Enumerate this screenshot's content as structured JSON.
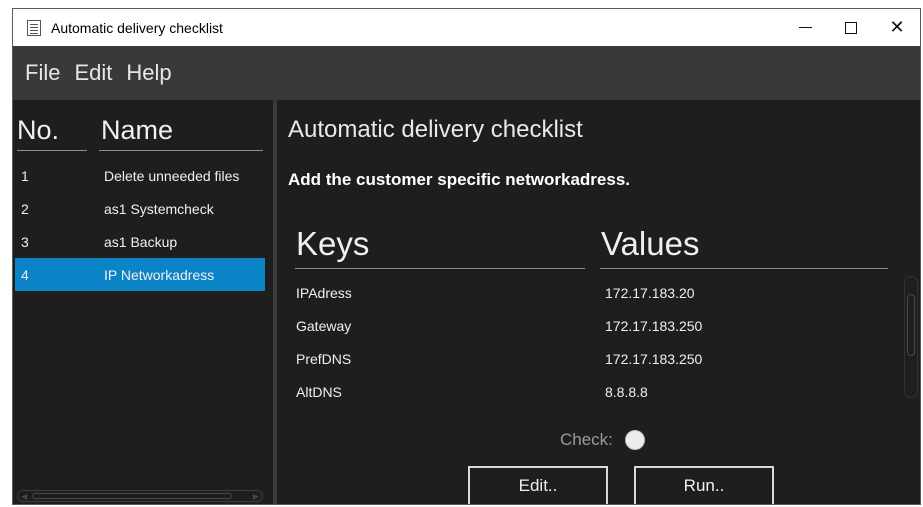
{
  "window": {
    "title": "Automatic delivery checklist",
    "controls": {
      "minimize": "–",
      "maximize": "☐",
      "close": "✕"
    }
  },
  "menu": [
    "File",
    "Edit",
    "Help"
  ],
  "sidebar": {
    "col_no": "No.",
    "col_name": "Name",
    "items": [
      {
        "no": "1",
        "name": "Delete unneeded files"
      },
      {
        "no": "2",
        "name": "as1 Systemcheck"
      },
      {
        "no": "3",
        "name": "as1 Backup"
      },
      {
        "no": "4",
        "name": "IP Networkadress"
      }
    ],
    "selected_index": 3
  },
  "main": {
    "title": "Automatic delivery checklist",
    "subtitle": "Add the customer specific networkadress.",
    "keys_header": "Keys",
    "values_header": "Values",
    "rows": [
      {
        "key": "IPAdress",
        "value": "172.17.183.20"
      },
      {
        "key": "Gateway",
        "value": "172.17.183.250"
      },
      {
        "key": "PrefDNS",
        "value": "172.17.183.250"
      },
      {
        "key": "AltDNS",
        "value": "8.8.8.8"
      }
    ],
    "check_label": "Check:",
    "edit_button": "Edit..",
    "run_button": "Run.."
  },
  "colors": {
    "background": "#1e1e1e",
    "menubar": "#393939",
    "selection": "#0a84c6",
    "text": "#f0f0f0"
  }
}
